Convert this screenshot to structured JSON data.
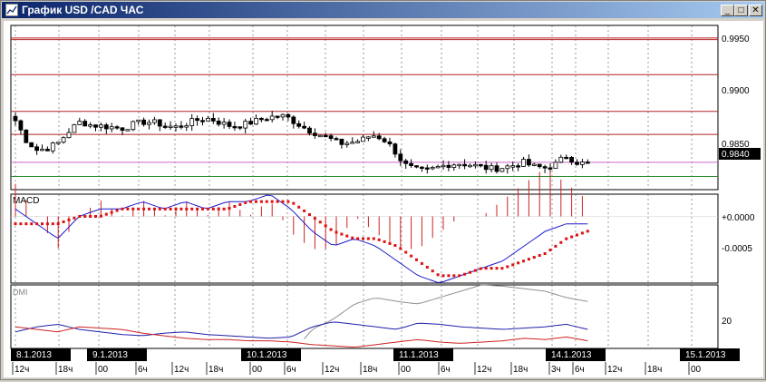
{
  "window": {
    "title": "График USD /CAD ЧАС",
    "buttons": {
      "minimize": "_",
      "maximize": "□",
      "close": "✕"
    }
  },
  "colors": {
    "candle": "#000000",
    "resistance_lines": "#b22222",
    "current_price_line": "#cc66cc",
    "support_line": "#2e8b2e",
    "macd_histogram": "#cc2222",
    "macd_line": "#1a1acc",
    "macd_signal": "#dd1111",
    "dmi_adx": "#909090",
    "dmi_plus": "#2020aa",
    "dmi_minus": "#cc2222"
  },
  "price_panel": {
    "axis_labels": [
      "0.9950",
      "0.9900",
      "0.9850"
    ],
    "current_price": "0.9840",
    "ylim": [
      0.9815,
      0.9965
    ]
  },
  "macd_panel": {
    "label": "MACD",
    "axis_labels": [
      "+0.0000",
      "-0.0005"
    ],
    "ylim": [
      -0.0009,
      0.0003
    ]
  },
  "dmi_panel": {
    "label": "DMI",
    "axis_labels": [
      "20"
    ],
    "ylim": [
      5,
      55
    ]
  },
  "time_axis": {
    "date_labels": [
      "8.1.2013",
      "9.1.2013",
      "10.1.2013",
      "11.1.2013",
      "14.1.2013",
      "15.1.2013"
    ],
    "hour_labels": [
      "12ч",
      "18ч",
      "00",
      "6ч",
      "12ч",
      "18ч",
      "00",
      "6ч",
      "12ч",
      "18ч",
      "00",
      "6ч",
      "12ч",
      "18ч",
      "3ч",
      "6ч",
      "12ч",
      "18ч",
      "00"
    ]
  },
  "chart_data": {
    "type": "candlestick",
    "title": "График USD /CAD ЧАС",
    "y_ticks": [
      0.995,
      0.99,
      0.985
    ],
    "horizontal_levels": {
      "resistance": [
        0.99535,
        0.9952,
        0.992,
        0.98865,
        0.98655
      ],
      "current": 0.984,
      "support": 0.9827
    },
    "current_price": 0.984,
    "close_anchors": [
      0.9878,
      0.986,
      0.9851,
      0.9853,
      0.9858,
      0.9869,
      0.9877,
      0.9874,
      0.9873,
      0.9872,
      0.9871,
      0.9875,
      0.9877,
      0.9876,
      0.9873,
      0.9872,
      0.9876,
      0.9879,
      0.988,
      0.9876,
      0.9873,
      0.9874,
      0.9877,
      0.988,
      0.9882,
      0.9882,
      0.9876,
      0.987,
      0.9866,
      0.9862,
      0.9857,
      0.9858,
      0.986,
      0.9865,
      0.9862,
      0.9852,
      0.9838,
      0.9833,
      0.9832,
      0.9835,
      0.9838,
      0.9839,
      0.9838,
      0.9836,
      0.9834,
      0.9835,
      0.9837,
      0.984,
      0.9836,
      0.9835,
      0.9838,
      0.9846,
      0.984,
      0.9838
    ]
  }
}
